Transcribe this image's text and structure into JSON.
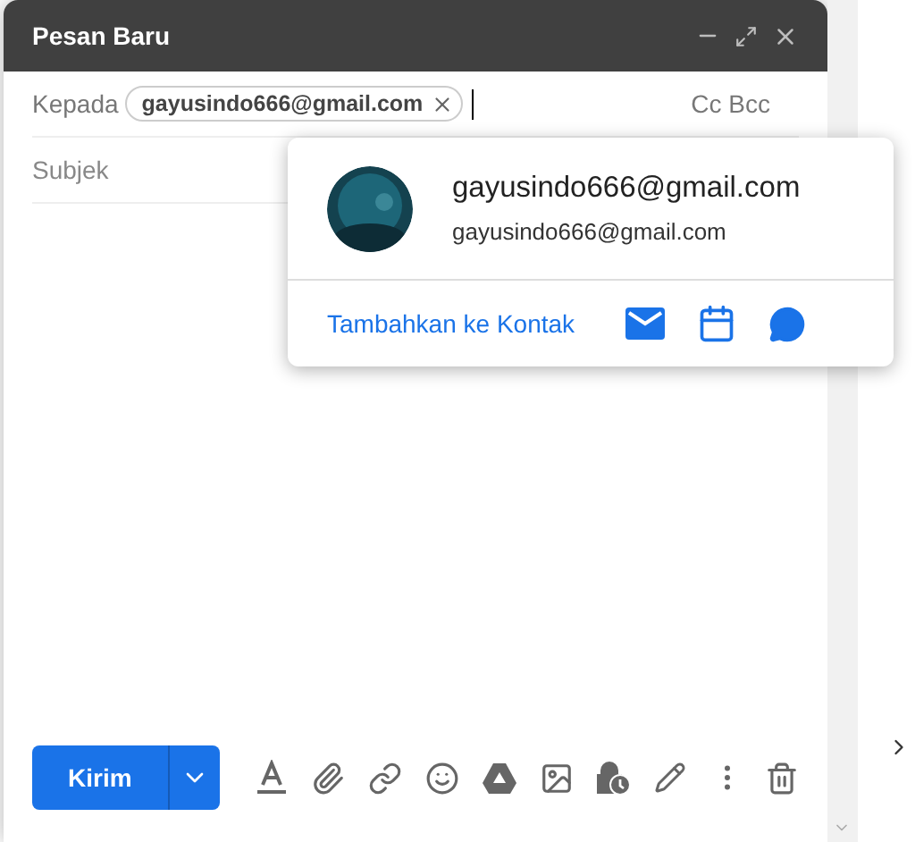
{
  "window": {
    "title": "Pesan Baru"
  },
  "to": {
    "label": "Kepada",
    "chips": [
      {
        "text": "gayusindo666@gmail.com"
      }
    ],
    "cc_bcc": "Cc Bcc"
  },
  "subject": {
    "placeholder": "Subjek"
  },
  "contact_card": {
    "name": "gayusindo666@gmail.com",
    "email": "gayusindo666@gmail.com",
    "add_link": "Tambahkan ke Kontak"
  },
  "send_button": "Kirim"
}
